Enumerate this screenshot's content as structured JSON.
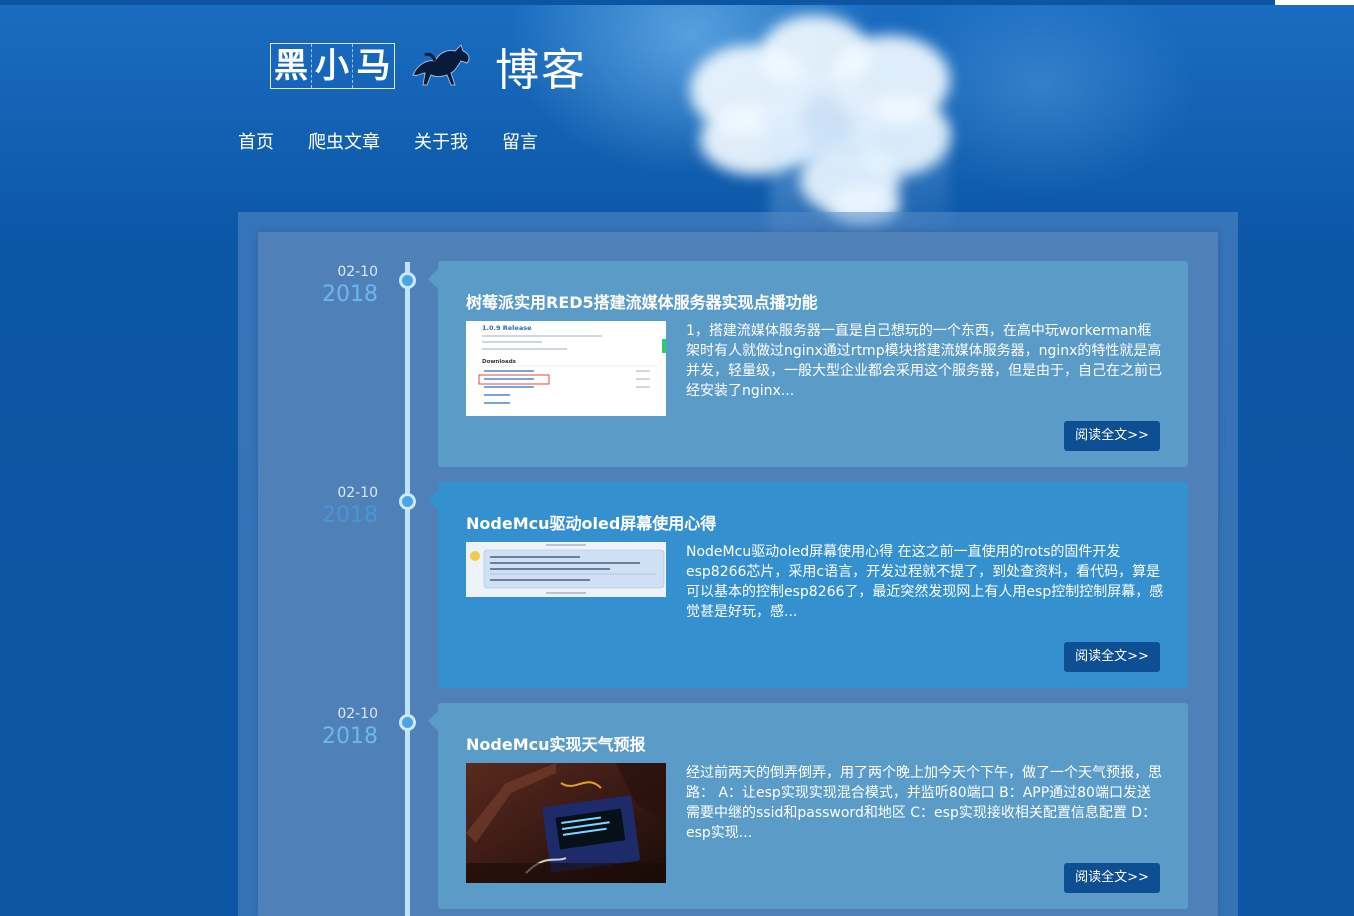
{
  "logo": {
    "chars": [
      "黑",
      "小",
      "马"
    ],
    "blog_text": "博客",
    "icon": "horse-icon"
  },
  "nav": [
    "首页",
    "爬虫文章",
    "关于我",
    "留言"
  ],
  "posts": [
    {
      "date_md": "02-10",
      "year": "2018",
      "title": "树莓派实用RED5搭建流媒体服务器实现点播功能",
      "excerpt": "1，搭建流媒体服务器一直是自己想玩的一个东西，在高中玩workerman框架时有人就做过nginx通过rtmp模块搭建流媒体服务器，nginx的特性就是高并发，轻量级，一般大型企业都会采用这个服务器，但是由于，自己在之前已经安装了nginx...",
      "read_more": "阅读全文>>",
      "thumb": {
        "heading": "1.0.9 Release",
        "section": "Downloads"
      }
    },
    {
      "date_md": "02-10",
      "year": "2018",
      "title": "NodeMcu驱动oled屏幕使用心得",
      "excerpt": "NodeMcu驱动oled屏幕使用心得 在这之前一直使用的rots的固件开发esp8266芯片，采用c语言，开发过程就不提了，到处查资料，看代码，算是可以基本的控制esp8266了，最近突然发现网上有人用esp控制控制屏幕，感觉甚是好玩，感...",
      "read_more": "阅读全文>>"
    },
    {
      "date_md": "02-10",
      "year": "2018",
      "title": "NodeMcu实现天气预报",
      "excerpt": "经过前两天的倒弄倒弄，用了两个晚上加今天个下午，做了一个天气预报，思路： A：让esp实现实现混合模式，并监听80端口 B：APP通过80端口发送需要中继的ssid和password和地区 C：esp实现接收相关配置信息配置 D：esp实现...",
      "read_more": "阅读全文>>"
    }
  ],
  "colors": {
    "background": "#0b55a3",
    "card_light": "#5b9bc8",
    "card_dark": "#3590d0",
    "button": "#0e4f94",
    "timeline": "#bfe2fb",
    "year": "#6fb6ec"
  }
}
